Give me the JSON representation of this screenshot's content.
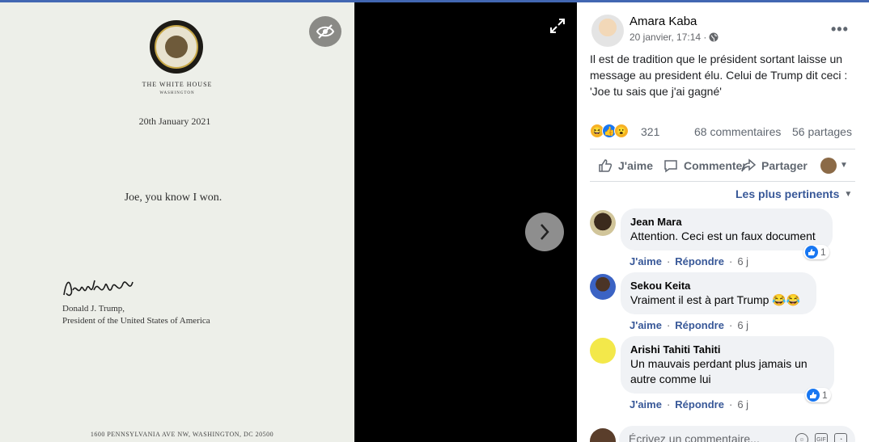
{
  "letter": {
    "letterhead_title": "THE WHITE HOUSE",
    "letterhead_sub": "WASHINGTON",
    "date": "20th January 2021",
    "message": "Joe, you know I won.",
    "signer_name": "Donald J. Trump,",
    "signer_title": "President of the United States of America",
    "address": "1600 PENNSYLVANIA AVE NW, WASHINGTON, DC 20500"
  },
  "post": {
    "author": "Amara Kaba",
    "timestamp": "20 janvier, 17:14 ·",
    "text": "Il est de tradition que le président sortant laisse un message au president élu. Celui de Trump dit ceci : 'Joe tu sais que j'ai gagné'",
    "reaction_count": "321",
    "comments_count": "68 commentaires",
    "shares_count": "56 partages"
  },
  "actions": {
    "like": "J'aime",
    "comment": "Commenter",
    "share": "Partager"
  },
  "sort_label": "Les plus pertinents",
  "comments": [
    {
      "name": "Jean Mara",
      "text": "Attention. Ceci est un faux document",
      "time": "6 j",
      "reactions": "1"
    },
    {
      "name": "Sekou Keita",
      "text": "Vraiment il est à part Trump 😂😂",
      "time": "6 j"
    },
    {
      "name": "Arishi Tahiti Tahiti",
      "text": "Un mauvais perdant plus jamais un autre comme lui",
      "time": "6 j",
      "reactions": "1"
    }
  ],
  "comment_actions": {
    "like": "J'aime",
    "reply": "Répondre",
    "sep": "·"
  },
  "composer": {
    "placeholder": "Écrivez un commentaire..."
  },
  "colors": {
    "accent": "#1877f2",
    "link": "#385898",
    "top_bar": "#4267b2"
  }
}
